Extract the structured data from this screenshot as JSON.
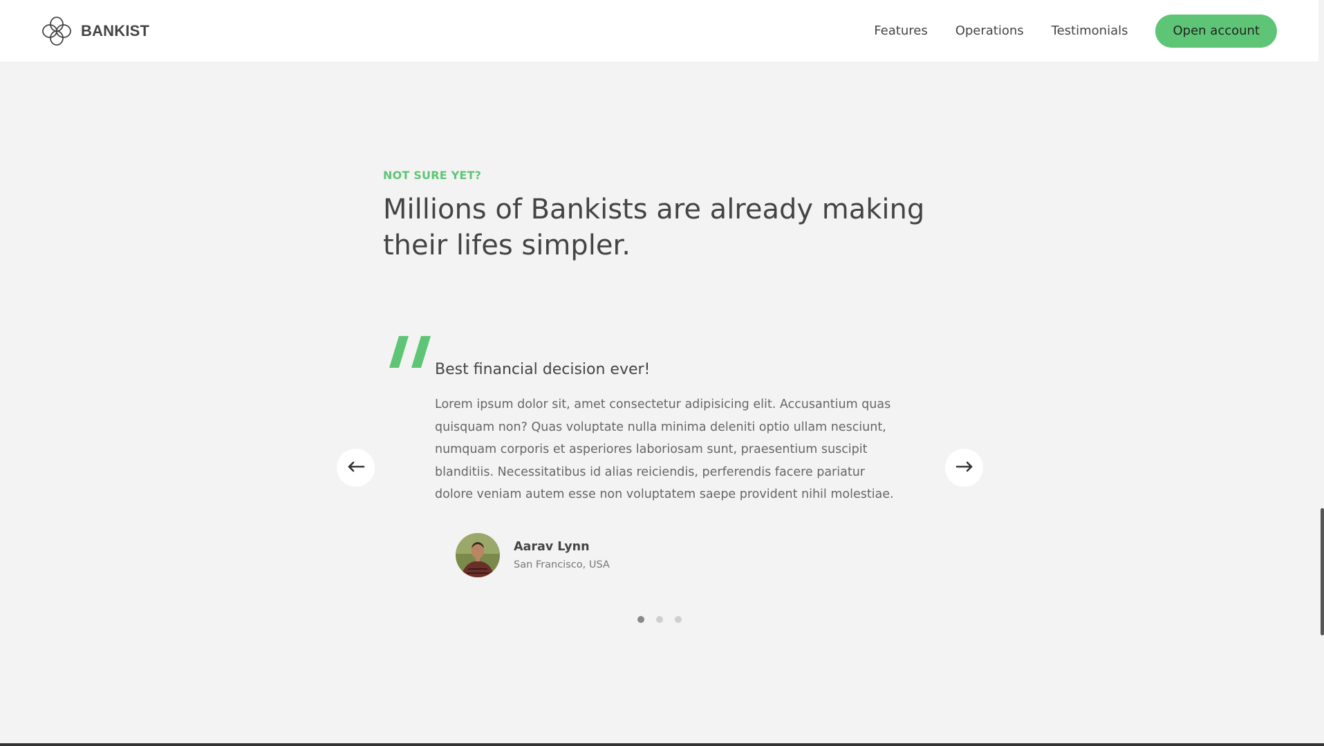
{
  "nav": {
    "brand": "BANKIST",
    "links": [
      "Features",
      "Operations",
      "Testimonials"
    ],
    "cta": "Open account"
  },
  "section": {
    "eyebrow": "Not sure yet?",
    "title_line1": "Millions of Bankists are already making",
    "title_line2": "their lifes simpler."
  },
  "testimonial": {
    "heading": "Best financial decision ever!",
    "text": "Lorem ipsum dolor sit, amet consectetur adipisicing elit. Accusantium quas quisquam non? Quas voluptate nulla minima deleniti optio ullam nesciunt, numquam corporis et asperiores laboriosam sunt, praesentium suscipit blanditiis. Necessitatibus id alias reiciendis, perferendis facere pariatur dolore veniam autem esse non voluptatem saepe provident nihil molestiae.",
    "author_name": "Aarav Lynn",
    "author_location": "San Francisco, USA"
  },
  "slider": {
    "prev_icon": "arrow-left-icon",
    "next_icon": "arrow-right-icon",
    "dot_count": 3,
    "active_dot": 1
  },
  "colors": {
    "accent": "#5ec576",
    "background": "#f3f3f3",
    "text": "#444444"
  }
}
